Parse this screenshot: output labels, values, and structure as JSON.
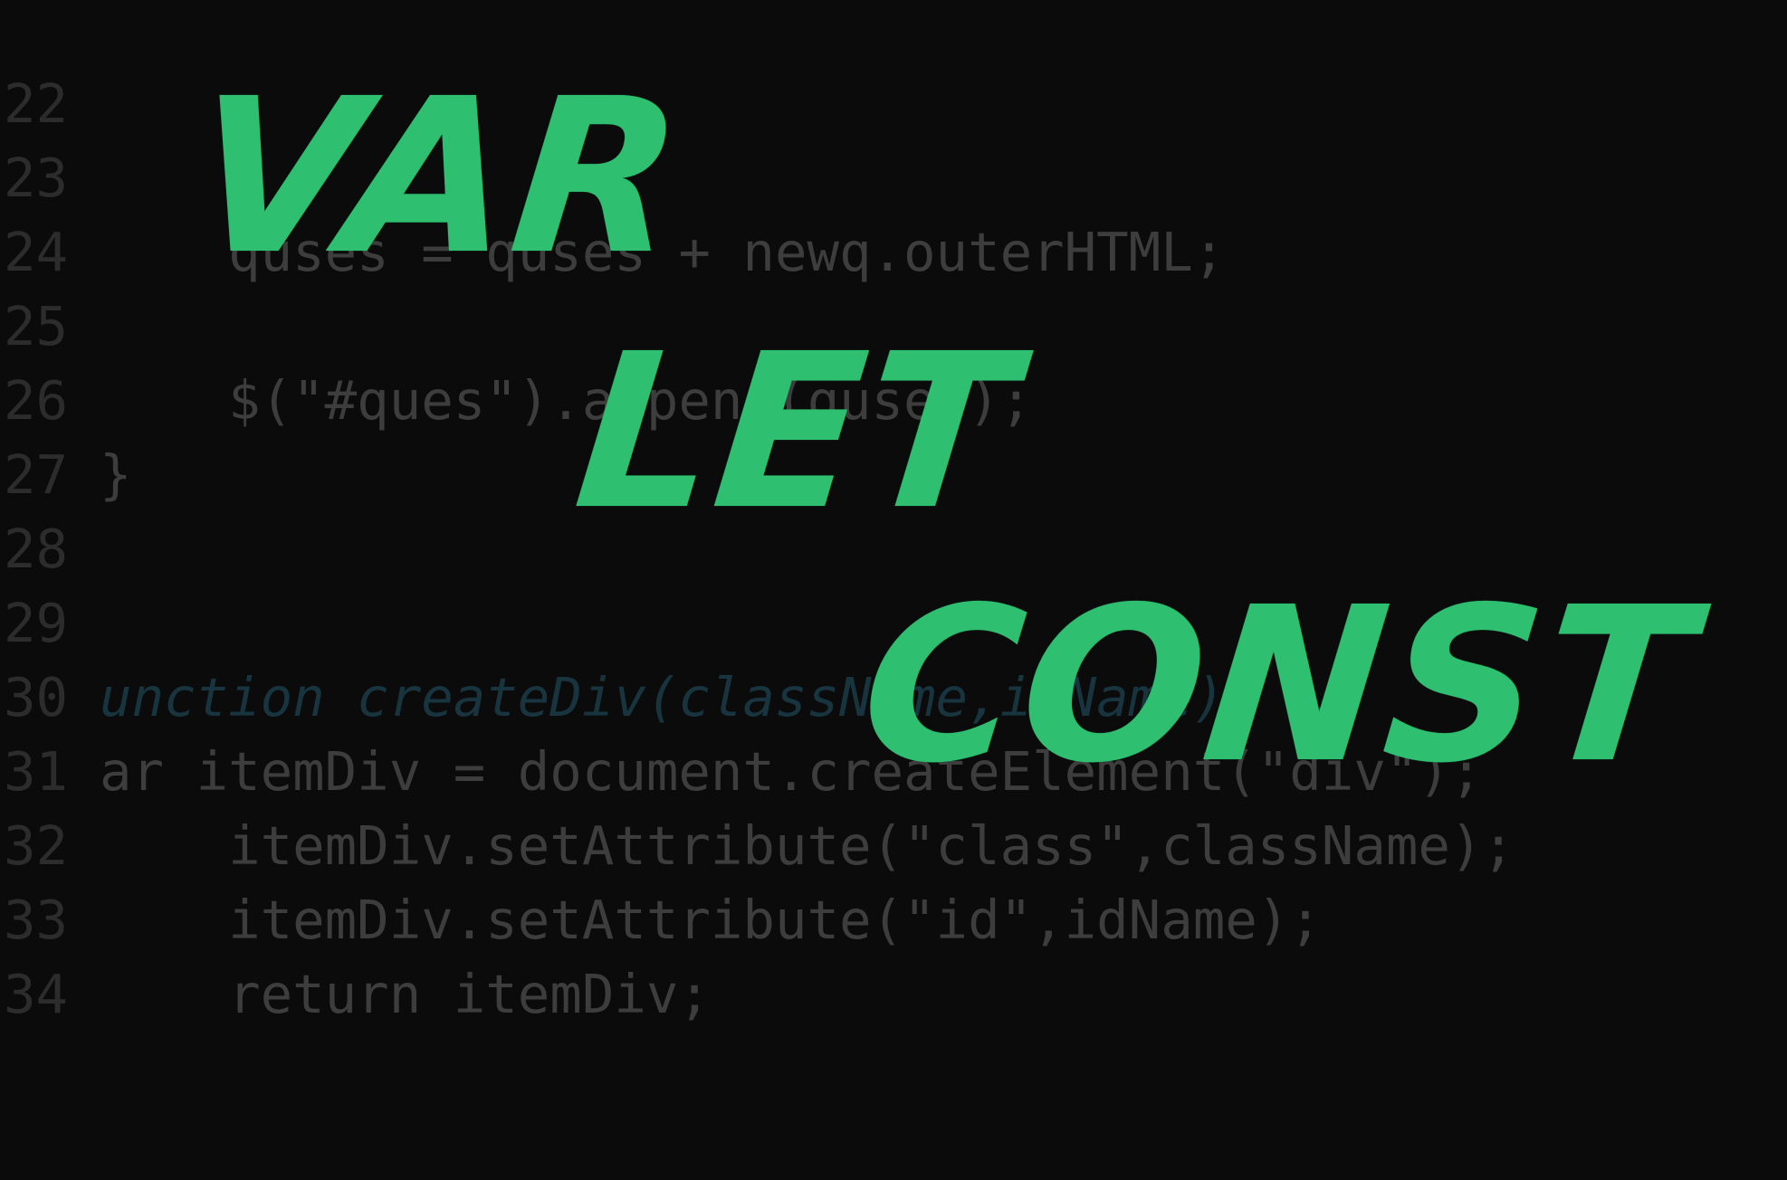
{
  "background_code": {
    "lines": [
      {
        "number": "22",
        "text": "    }"
      },
      {
        "number": "23",
        "text": "    quses = quses + newq.outerHTML;"
      },
      {
        "number": "24",
        "text": ""
      },
      {
        "number": "25",
        "text": "    $(\"#ques\").append(quses);"
      },
      {
        "number": "26",
        "text": "}"
      },
      {
        "number": "27",
        "text": ""
      },
      {
        "number": "28",
        "text": ""
      },
      {
        "number": "29",
        "text": "unction createDiv(className,idName){"
      },
      {
        "number": "30",
        "text": "ar itemDiv = document.createElement(\"div\");"
      },
      {
        "number": "31",
        "text": "    itemDiv.setAttribute(\"class\",className);"
      },
      {
        "number": "32",
        "text": "    itemDiv.setAttribute(\"id\",idName);"
      },
      {
        "number": "33",
        "text": "    return itemDiv;"
      },
      {
        "number": "34",
        "text": ""
      }
    ]
  },
  "title": {
    "words": [
      "VAR",
      "LET",
      "CONST"
    ],
    "color": "#2fbf71"
  }
}
